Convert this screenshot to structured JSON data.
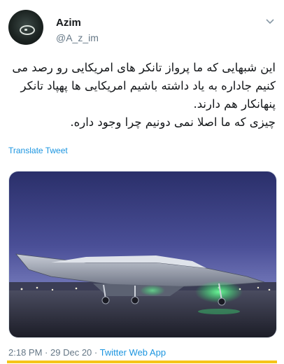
{
  "user": {
    "display_name": "Azim",
    "handle": "@A_z_im"
  },
  "icons": {
    "menu": "chevron-down-icon",
    "avatar": "profile-avatar"
  },
  "tweet": {
    "lines": [
      "این شبهایی که ما پرواز تانکر های امریکایی رو رصد می کنیم جاداره به یاد داشته باشیم امریکایی ها پهپاد تانکر پنهانکار هم دارند.",
      "چیزی که ما اصلا نمی دونیم چرا وجود داره."
    ],
    "translate_label": "Translate Tweet"
  },
  "meta": {
    "time": "2:18 PM",
    "separator": "·",
    "date": "29 Dec 20",
    "source": "Twitter Web App"
  },
  "colors": {
    "link": "#1b95e0",
    "muted": "#657786",
    "text": "#14171a",
    "highlight": "#f5c518"
  }
}
